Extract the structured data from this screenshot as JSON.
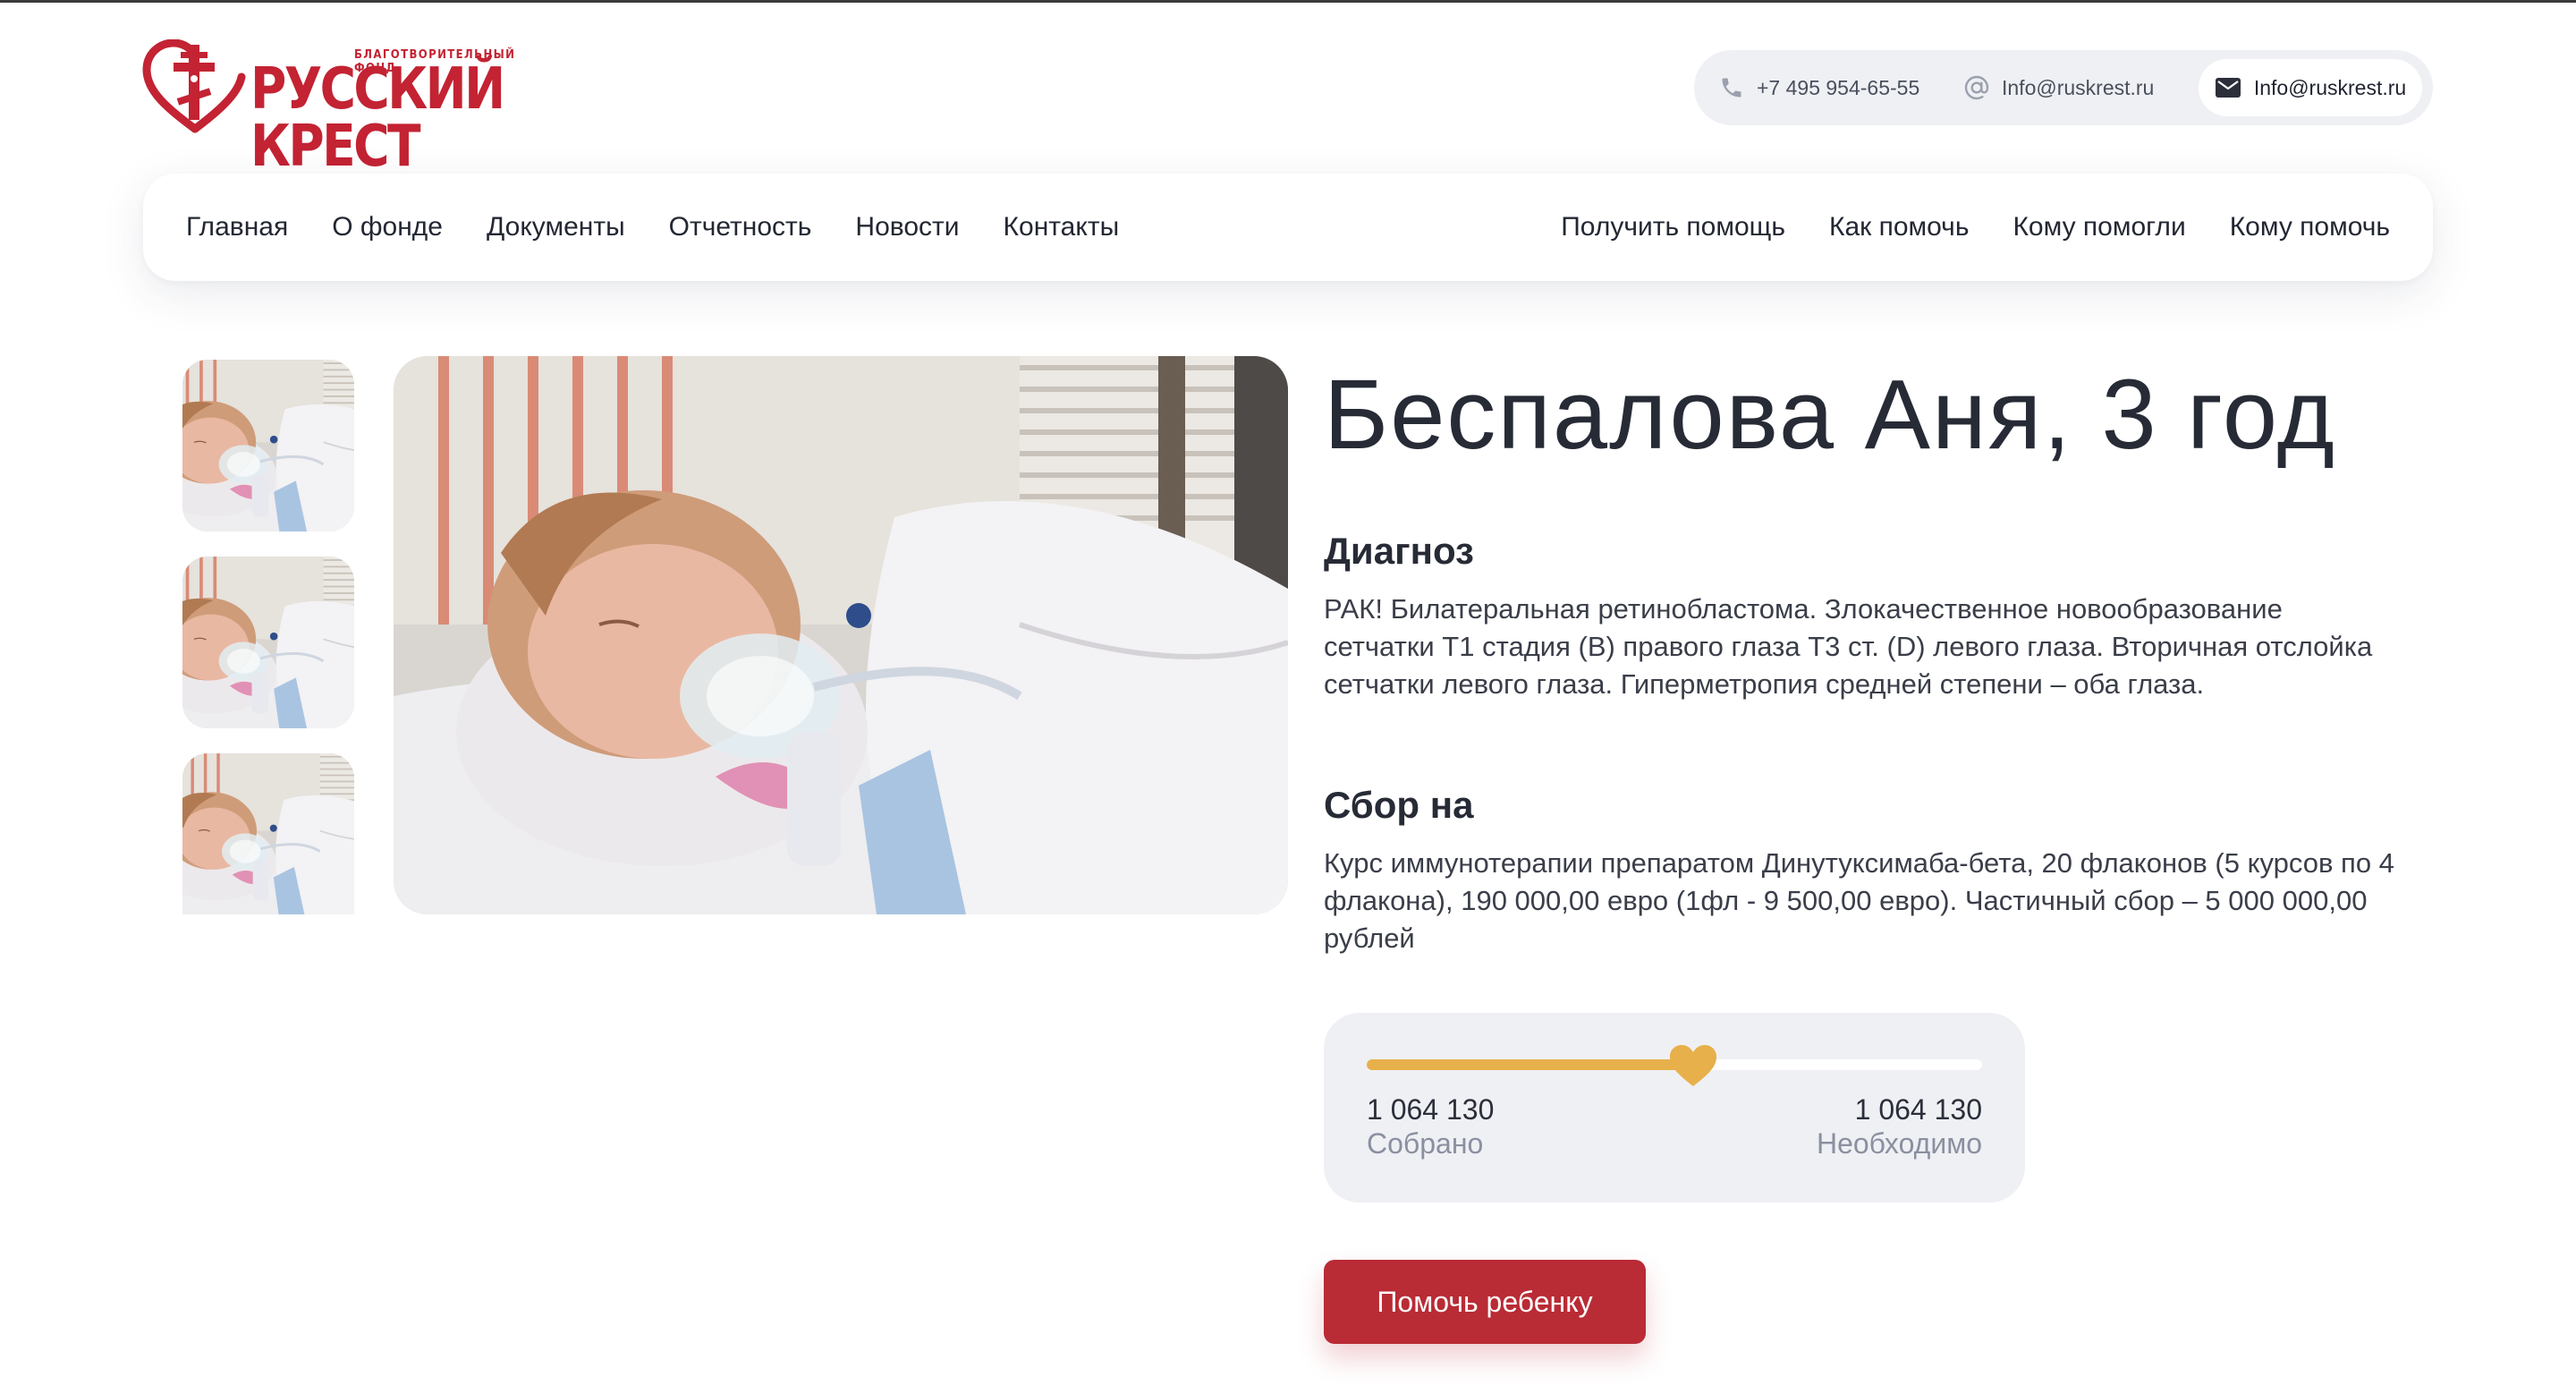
{
  "brand": {
    "tagline": "БЛАГОТВОРИТЕЛЬНЫЙ ФОНД",
    "name": "РУССКИЙ КРЕСТ",
    "color": "#c32333"
  },
  "contacts": {
    "phone": "+7 495 954-65-55",
    "email_at": "Info@ruskrest.ru",
    "email_mail": "Info@ruskrest.ru"
  },
  "nav": {
    "left": [
      "Главная",
      "О фонде",
      "Документы",
      "Отчетность",
      "Новости",
      "Контакты"
    ],
    "right": [
      "Получить помощь",
      "Как помочь",
      "Кому помогли",
      "Кому помочь"
    ]
  },
  "child": {
    "name": "Беспалова Аня, 3 год",
    "diagnosis_title": "Диагноз",
    "diagnosis_text": "РАК! Билатеральная ретинобластома. Злокачественное новообразование сетчатки Т1 стадия (B) правого глаза Т3 ст. (D) левого глаза. Вторичная отслойка сетчатки левого глаза. Гиперметропия средней степени – оба глаза.",
    "goal_title": "Сбор на",
    "goal_text": "Курс иммунотерапии препаратом Динутуксимаба-бета, 20 флаконов (5 курсов по 4 флакона), 190 000,00 евро (1фл - 9 500,00 евро). Частичный сбор – 5 000 000,00 рублей"
  },
  "fundraising": {
    "collected_value": "1 064 130",
    "collected_label": "Собрано",
    "needed_value": "1 064 130",
    "needed_label": "Необходимо",
    "progress_fraction": 0.53,
    "accent_color": "#e7b04a"
  },
  "cta": {
    "label": "Помочь ребенку",
    "color": "#b92b35"
  }
}
